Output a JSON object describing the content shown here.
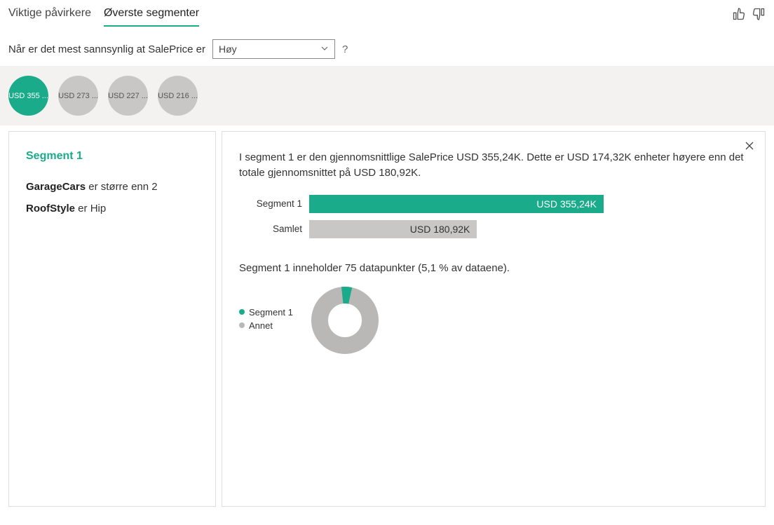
{
  "tabs": {
    "influencers": "Viktige påvirkere",
    "segments": "Øverste segmenter"
  },
  "filter": {
    "prefix": "Når er det mest sannsynlig at SalePrice er",
    "selected": "Høy",
    "help": "?"
  },
  "bubbles": [
    {
      "label": "USD 355 ...",
      "active": true
    },
    {
      "label": "USD 273 ...",
      "active": false
    },
    {
      "label": "USD 227 ...",
      "active": false
    },
    {
      "label": "USD 216 ...",
      "active": false
    }
  ],
  "left_panel": {
    "title": "Segment 1",
    "conditions": [
      {
        "field": "GarageCars",
        "rest": " er større enn 2"
      },
      {
        "field": "RoofStyle",
        "rest": " er Hip"
      }
    ]
  },
  "right_panel": {
    "summary": "I segment 1 er den gjennomsnittlige SalePrice USD 355,24K. Dette er USD 174,32K enheter høyere enn det totale gjennomsnittet på USD 180,92K.",
    "bars": {
      "row1_label": "Segment 1",
      "row1_value": "USD 355,24K",
      "row2_label": "Samlet",
      "row2_value": "USD 180,92K"
    },
    "donut_intro": "Segment 1 inneholder 75 datapunkter (5,1 % av dataene).",
    "legend": {
      "seg": "Segment 1",
      "other": "Annet"
    }
  },
  "chart_data": [
    {
      "type": "bar",
      "categories": [
        "Segment 1",
        "Samlet"
      ],
      "values": [
        355.24,
        180.92
      ],
      "unit": "USD K",
      "xlim": [
        0,
        355.24
      ]
    },
    {
      "type": "pie",
      "series": [
        {
          "name": "Segment 1",
          "value": 5.1
        },
        {
          "name": "Annet",
          "value": 94.9
        }
      ],
      "unit": "%",
      "count": 75
    }
  ]
}
